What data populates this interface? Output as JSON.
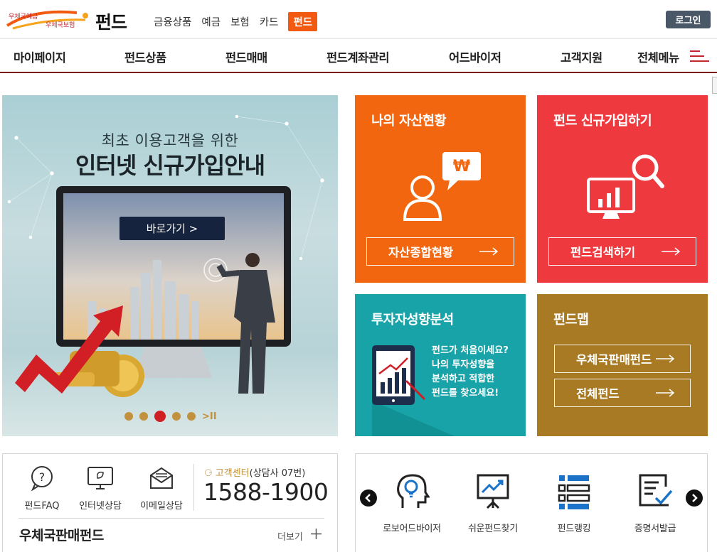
{
  "logo": {
    "line1": "우체국예금",
    "line2": "우체국보험"
  },
  "brand": "펀드",
  "topnav": [
    "금융상품",
    "예금",
    "보험",
    "카드"
  ],
  "topnav_active": "펀드",
  "login": "로그인",
  "mainnav": [
    "마이페이지",
    "펀드상품",
    "펀드매매",
    "펀드계좌관리",
    "어드바이저",
    "고객지원",
    "전체메뉴"
  ],
  "banner": {
    "subtitle": "최초 이용고객을 위한",
    "title": "인터넷 신규가입안내",
    "button": "바로가기 >",
    "slide_current": 3,
    "slide_count": 5,
    "play_label": ">II"
  },
  "tiles": {
    "asset": {
      "title": "나의 자산현황",
      "button": "자산종합현황",
      "badge": "₩"
    },
    "join": {
      "title": "펀드 신규가입하기",
      "button": "펀드검색하기"
    },
    "invest": {
      "title": "투자자성향분석",
      "desc": [
        "펀드가 처음이세요?",
        "나의 투자성향을",
        "분석하고 적합한",
        "펀드를 찾으세요!"
      ]
    },
    "map": {
      "title": "펀드맵",
      "buttons": [
        "우체국판매펀드",
        "전체펀드"
      ]
    }
  },
  "quick": [
    {
      "label": "펀드FAQ",
      "icon": "question-icon"
    },
    {
      "label": "인터넷상담",
      "icon": "monitor-chat-icon"
    },
    {
      "label": "이메일상담",
      "icon": "mail-icon"
    }
  ],
  "contact": {
    "label": "고객센터",
    "note": "(상담사 07번)",
    "phone": "1588-1900"
  },
  "fund_section": {
    "title": "우체국판매펀드",
    "more": "더보기"
  },
  "services": [
    {
      "label": "로보어드바이저",
      "icon": "robo-advisor-icon"
    },
    {
      "label": "쉬운펀드찾기",
      "icon": "presentation-chart-icon"
    },
    {
      "label": "펀드랭킹",
      "icon": "ranking-list-icon"
    },
    {
      "label": "증명서발급",
      "icon": "certificate-icon"
    }
  ],
  "colors": {
    "orange": "#f2660f",
    "red": "#ee3a3e",
    "teal": "#17a3a8",
    "gold": "#a87a24",
    "navy": "#15233f"
  }
}
